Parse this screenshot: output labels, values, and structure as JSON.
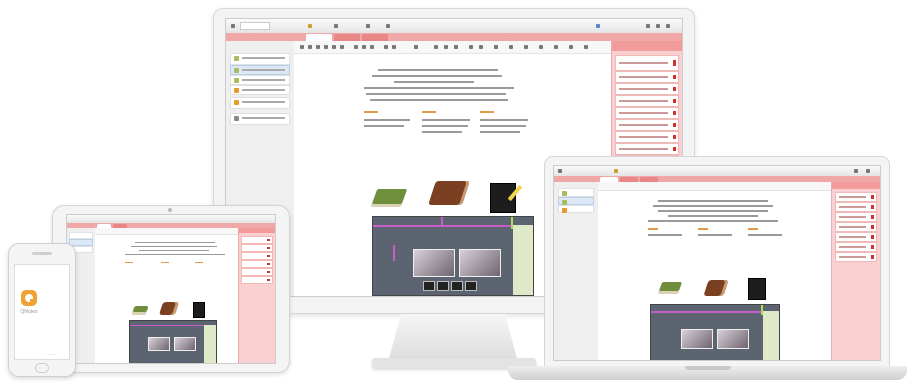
{
  "app": {
    "name": "QNotes",
    "phone_footer": "———"
  },
  "colors": {
    "accent": "#f19b9a",
    "tab_bar": "#f0a7a7",
    "panel_bg": "#f9d0cf",
    "logo": "#f0a233"
  },
  "icons": [
    "qnotes-logo-icon",
    "green-book-icon",
    "brown-book-icon",
    "notebook-pencil-icon"
  ]
}
